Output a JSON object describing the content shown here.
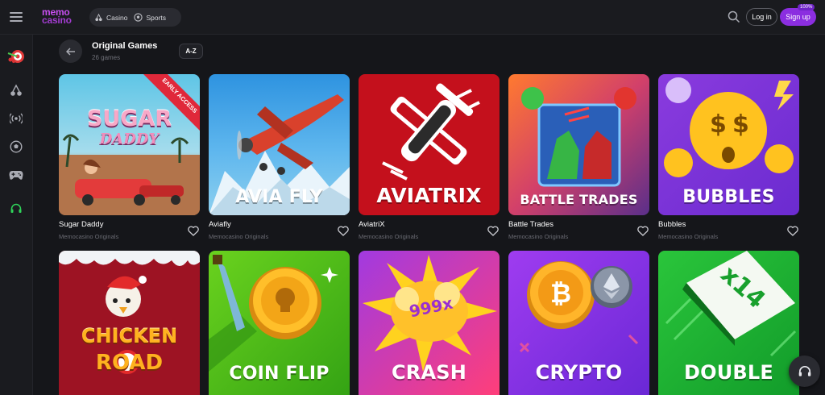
{
  "logo": {
    "line1": "memo",
    "line2": "casino"
  },
  "nav": {
    "casino": "Casino",
    "sports": "Sports"
  },
  "auth": {
    "login": "Log in",
    "signup": "Sign up",
    "badge": "100%"
  },
  "section": {
    "title": "Original Games",
    "count": "26 games",
    "sort": "A-Z"
  },
  "games": [
    {
      "title": "Sugar Daddy",
      "provider": "Memocasino Originals",
      "art_l1": "SUGAR",
      "art_l2": "DADDY",
      "ribbon": "EARLY ACCESS"
    },
    {
      "title": "Aviafly",
      "provider": "Memocasino Originals",
      "caption": "AVIA FLY"
    },
    {
      "title": "AviatriX",
      "provider": "Memocasino Originals",
      "caption": "AVIATRIX"
    },
    {
      "title": "Battle Trades",
      "provider": "Memocasino Originals",
      "caption": "BATTLE TRADES"
    },
    {
      "title": "Bubbles",
      "provider": "Memocasino Originals",
      "caption": "BUBBLES"
    },
    {
      "title": "",
      "provider": "",
      "art_l1": "CHICKEN",
      "art_l2": "ROAD"
    },
    {
      "title": "",
      "provider": "",
      "caption": "COIN FLIP"
    },
    {
      "title": "",
      "provider": "",
      "caption": "CRASH",
      "multiplier": "999x"
    },
    {
      "title": "",
      "provider": "",
      "caption": "CRYPTO"
    },
    {
      "title": "",
      "provider": "",
      "caption": "DOUBLE",
      "multiplier": "x14"
    }
  ]
}
